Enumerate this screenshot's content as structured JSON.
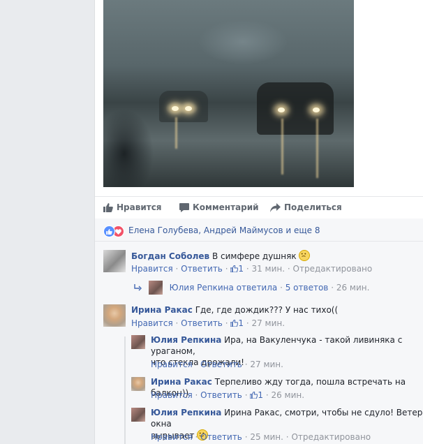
{
  "post": {
    "actions": {
      "like": "Нравится",
      "comment": "Комментарий",
      "share": "Поделиться"
    },
    "reactions_text": "Елена Голубева, Андрей Маймусов и еще 8"
  },
  "comments": [
    {
      "author": "Богдан Соболев",
      "text": "В симфере душняк",
      "like": "Нравится",
      "reply": "Ответить",
      "likes": "1",
      "time": "31 мин.",
      "edited": "Отредактировано",
      "replies_summary": {
        "author": "Юлия Репкина",
        "text": "ответила",
        "count": "5 ответов",
        "time": "26 мин."
      }
    },
    {
      "author": "Ирина Ракас",
      "text": "Где, где дождик??? У нас тихо((",
      "like": "Нравится",
      "reply": "Ответить",
      "likes": "1",
      "time": "27 мин.",
      "replies": [
        {
          "author": "Юлия Репкина",
          "text_line1": "Ира, на Вакуленчука - такой ливиняка с ураганом,",
          "text_line2": "что стекла дрожали!",
          "like": "Нравится",
          "reply": "Ответить",
          "time": "27 мин."
        },
        {
          "author": "Ирина Ракас",
          "text": "Терпеливо жду тогда, пошла встречать на балкон))",
          "like": "Нравится",
          "reply": "Ответить",
          "likes": "1",
          "time": "26 мин."
        },
        {
          "author": "Юлия Репкина",
          "text_line1": "Ирина Ракас, смотри, чтобы не сдуло! Ветер окна",
          "text_line2": "вырывает",
          "like": "Нравится",
          "reply": "Ответить",
          "time": "25 мин.",
          "edited": "Отредактировано"
        }
      ]
    }
  ],
  "colors": {
    "link": "#365899",
    "action_link": "#4267b2",
    "meta": "#90949c",
    "like_blue": "#5890ff",
    "love_red": "#f25268"
  },
  "icons": [
    "thumbs-up-icon",
    "comment-icon",
    "share-arrow-icon",
    "like-reaction-icon",
    "love-reaction-icon",
    "reply-arrow-icon",
    "smiley-icon"
  ]
}
